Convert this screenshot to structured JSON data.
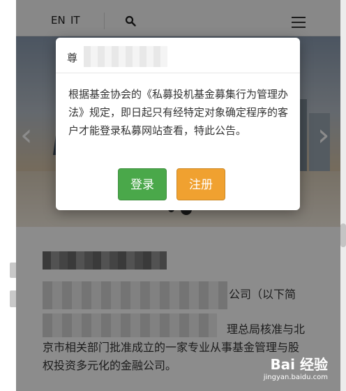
{
  "header": {
    "lang_en": "EN",
    "lang_it": "IT",
    "search_icon": "search-icon",
    "menu_icon": "hamburger-menu-icon"
  },
  "hero": {
    "prev_arrow": "‹",
    "next_arrow": "›",
    "slide_count": 2,
    "active_slide": 2
  },
  "modal": {
    "title": "尊",
    "body": "根据基金协会的《私募投机基金募集行为管理办法》规定，即日起只有经特定对象确定程序的客户才能登录私募网站查看，特此公告。",
    "login_label": "登录",
    "register_label": "注册",
    "login_color": "#4aa84a",
    "register_color": "#f0a130"
  },
  "content": {
    "line1_suffix": "公司（以下简",
    "line2": "理总局核准与北",
    "line3": "京市相关部门批准成立的一家专业从事基金管理与股",
    "line4": "权投资多元化的金融公司。"
  },
  "watermark": {
    "logo": "Bai 经验",
    "url": "jingyan.baidu.com"
  }
}
